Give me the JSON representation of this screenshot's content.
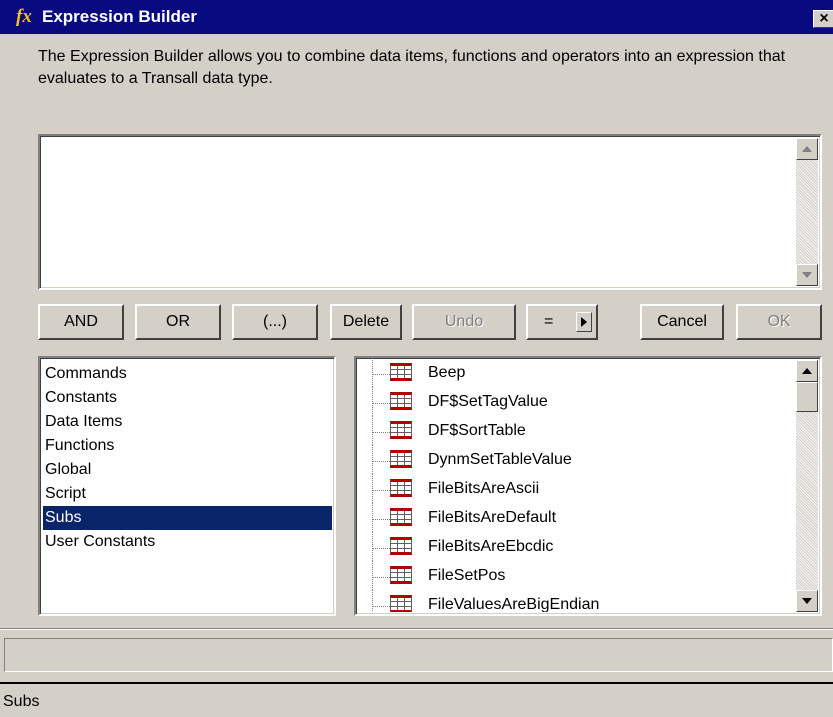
{
  "window": {
    "icon_label": "fx",
    "title": "Expression Builder",
    "close_label": "×"
  },
  "description": "The Expression Builder allows you to combine data items, functions and operators into an expression that evaluates to a Transall data type.",
  "expression": {
    "value": ""
  },
  "buttons": {
    "and": "AND",
    "or": "OR",
    "parens": "(...)",
    "delete": "Delete",
    "undo": "Undo",
    "equals": "=",
    "cancel": "Cancel",
    "ok": "OK"
  },
  "categories": {
    "items": [
      "Commands",
      "Constants",
      "Data Items",
      "Functions",
      "Global",
      "Script",
      "Subs",
      "User Constants"
    ],
    "selected": "Subs"
  },
  "subs": {
    "items": [
      "Beep",
      "DF$SetTagValue",
      "DF$SortTable",
      "DynmSetTableValue",
      "FileBitsAreAscii",
      "FileBitsAreDefault",
      "FileBitsAreEbcdic",
      "FileSetPos",
      "FileValuesAreBigEndian"
    ],
    "item_icon": "table-icon"
  },
  "status": {
    "top_text": "",
    "bottom_text": "Subs"
  }
}
